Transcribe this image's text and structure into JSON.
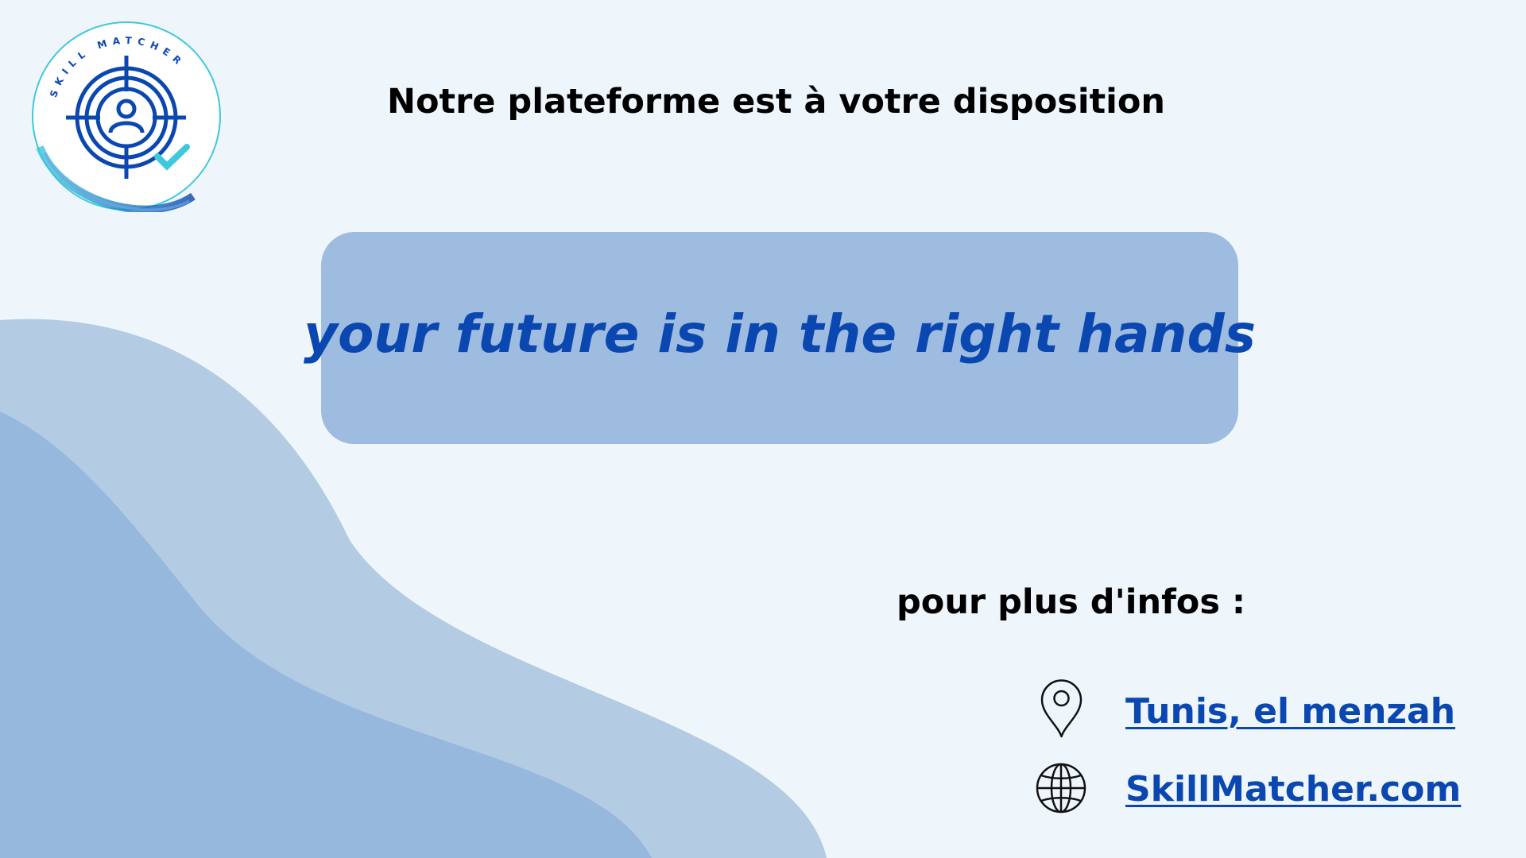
{
  "logo": {
    "ring_text": "SKILL MATCHER",
    "icon": "target-person-check-icon",
    "colors": {
      "primary": "#0b47b0",
      "accent": "#3ec8dc"
    }
  },
  "headline": "Notre plateforme est à votre disposition",
  "banner": {
    "tagline": "your future is in the right hands"
  },
  "contact": {
    "label": "pour plus d'infos :",
    "items": [
      {
        "icon": "location-pin-icon",
        "text": "Tunis, el menzah"
      },
      {
        "icon": "globe-icon",
        "text": "SkillMatcher.com "
      }
    ]
  },
  "colors": {
    "background": "#eef6fb",
    "wave_light": "#b3cbe3",
    "wave_dark": "#96b8dc",
    "banner": "#9ebce0",
    "accent_text": "#0b47b0"
  }
}
